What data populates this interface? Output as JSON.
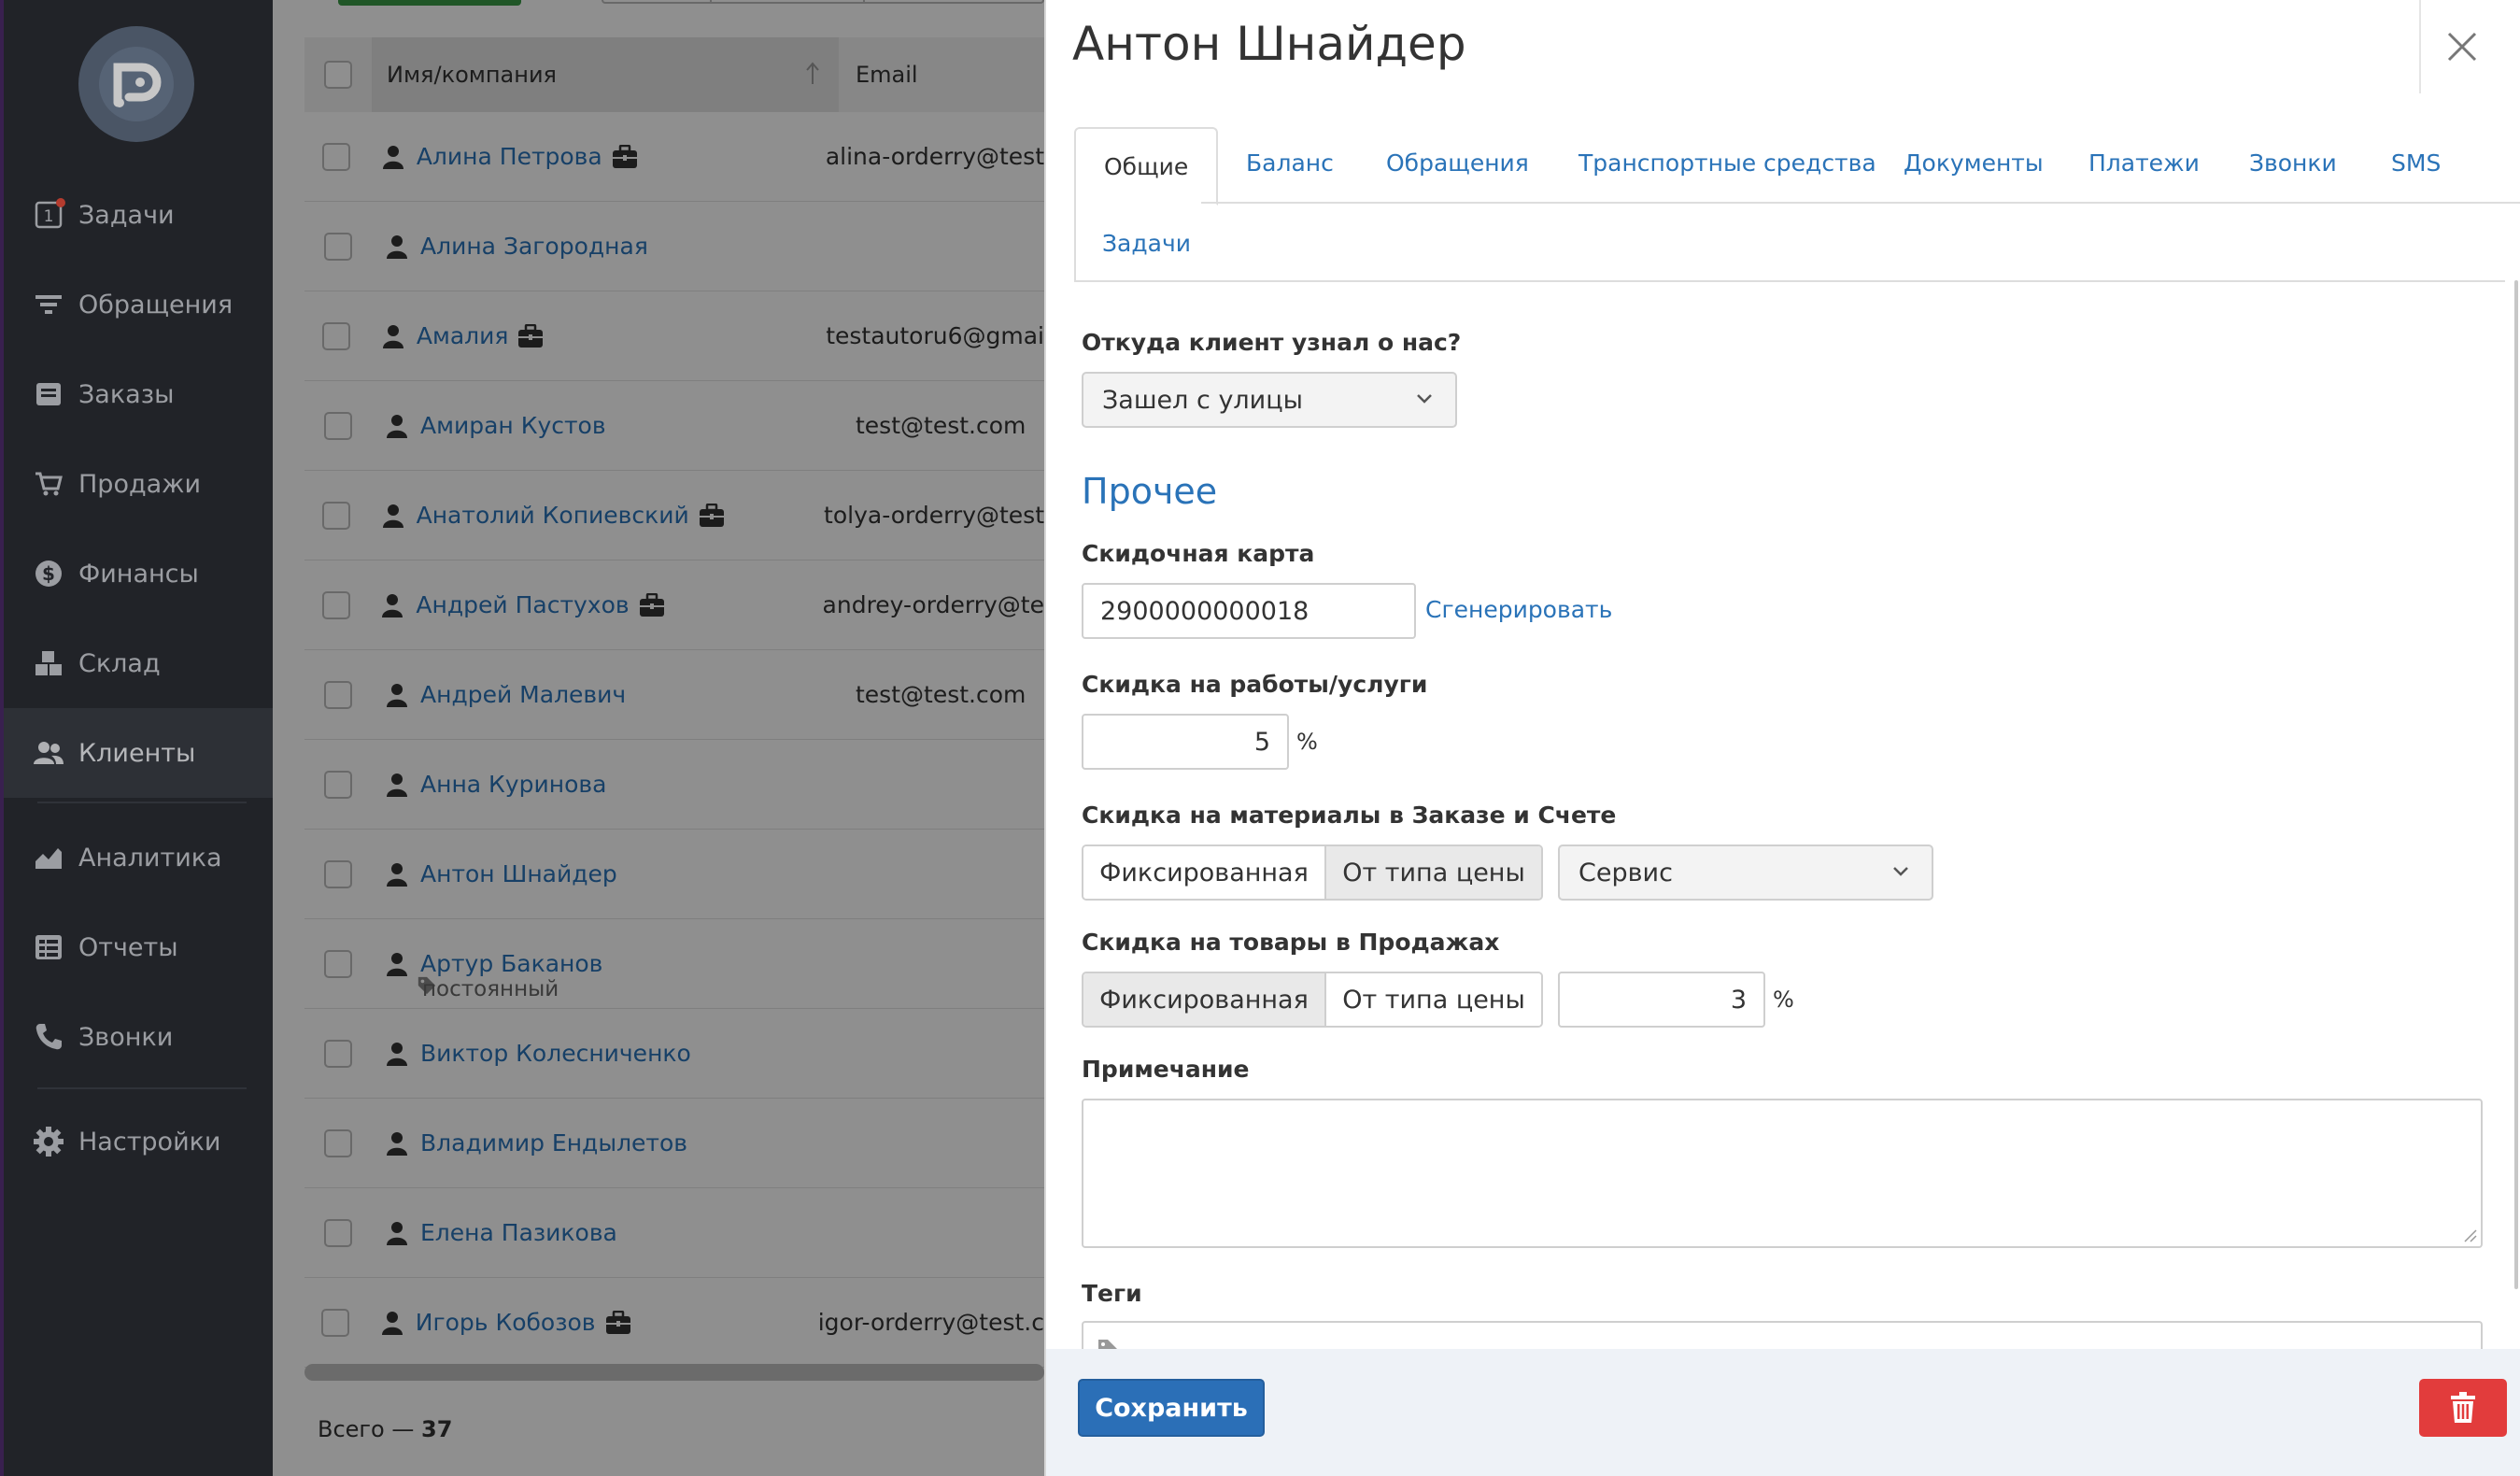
{
  "sidebar": {
    "items": [
      {
        "label": "Задачи",
        "icon": "tasks-icon"
      },
      {
        "label": "Обращения",
        "icon": "filter-icon"
      },
      {
        "label": "Заказы",
        "icon": "orders-icon"
      },
      {
        "label": "Продажи",
        "icon": "cart-icon"
      },
      {
        "label": "Финансы",
        "icon": "dollar-icon"
      },
      {
        "label": "Склад",
        "icon": "boxes-icon"
      },
      {
        "label": "Клиенты",
        "icon": "users-icon",
        "active": true
      },
      {
        "label": "Аналитика",
        "icon": "chart-icon"
      },
      {
        "label": "Отчеты",
        "icon": "reports-icon"
      },
      {
        "label": "Звонки",
        "icon": "phone-icon"
      },
      {
        "label": "Настройки",
        "icon": "gear-icon"
      }
    ],
    "tasks_badge_icon_text": "1"
  },
  "list": {
    "columns": {
      "name": "Имя/компания",
      "email": "Email"
    },
    "rows": [
      {
        "name": "Алина Петрова",
        "company": true,
        "email": "alina-orderry@test"
      },
      {
        "name": "Алина Загородная",
        "company": false,
        "email": ""
      },
      {
        "name": "Амалия",
        "company": true,
        "email": "testautoru6@gmai"
      },
      {
        "name": "Амиран Кустов",
        "company": false,
        "email": "test@test.com"
      },
      {
        "name": "Анатолий Копиевский",
        "company": true,
        "email": "tolya-orderry@test"
      },
      {
        "name": "Андрей Пастухов",
        "company": true,
        "email": "andrey-orderry@te"
      },
      {
        "name": "Андрей Малевич",
        "company": false,
        "email": "test@test.com"
      },
      {
        "name": "Анна Куринова",
        "company": false,
        "email": ""
      },
      {
        "name": "Антон Шнайдер",
        "company": false,
        "email": ""
      },
      {
        "name": "Артур Баканов",
        "company": false,
        "email": "",
        "tag": "постоянный"
      },
      {
        "name": "Виктор Колесниченко",
        "company": false,
        "email": ""
      },
      {
        "name": "Владимир Ендылетов",
        "company": false,
        "email": ""
      },
      {
        "name": "Елена Пазикова",
        "company": false,
        "email": ""
      },
      {
        "name": "Игорь Кобозов",
        "company": true,
        "email": "igor-orderry@test.c"
      }
    ],
    "total_label": "Всего —",
    "total_value": "37"
  },
  "panel": {
    "title": "Антон Шнайдер",
    "tabs": [
      "Общие",
      "Баланс",
      "Обращения",
      "Транспортные средства",
      "Документы",
      "Платежи",
      "Звонки",
      "SMS",
      "Задачи"
    ],
    "source": {
      "label": "Откуда клиент узнал о нас?",
      "value": "Зашел с улицы"
    },
    "section_other": "Прочее",
    "card": {
      "label": "Скидочная карта",
      "value": "2900000000018",
      "generate": "Сгенерировать"
    },
    "discount_work": {
      "label": "Скидка на работы/услуги",
      "value": "5",
      "unit": "%"
    },
    "discount_materials": {
      "label": "Скидка на материалы в Заказе и Счете",
      "options": [
        "Фиксированная",
        "От типа цены"
      ],
      "selected": "От типа цены",
      "price_type": "Сервис"
    },
    "discount_goods": {
      "label": "Скидка на товары в Продажах",
      "options": [
        "Фиксированная",
        "От типа цены"
      ],
      "selected": "Фиксированная",
      "value": "3",
      "unit": "%"
    },
    "note": {
      "label": "Примечание",
      "value": ""
    },
    "tags": {
      "label": "Теги"
    },
    "save_label": "Сохранить"
  },
  "colors": {
    "sidebar_bg": "#2b2e34",
    "link": "#2a73b8",
    "save": "#2b6fb7",
    "delete": "#e23c3c",
    "footer_bg": "#eef2f7"
  }
}
